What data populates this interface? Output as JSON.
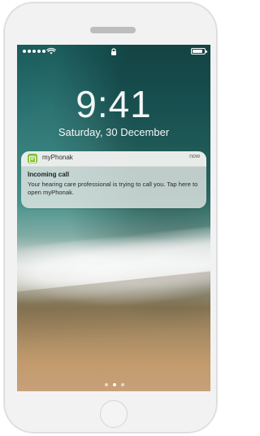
{
  "lock_screen": {
    "time": "9:41",
    "date": "Saturday, 30 December",
    "battery_level": 0.85
  },
  "notification": {
    "app_name": "myPhonak",
    "timestamp": "now",
    "title": "Incoming call",
    "body": "Your hearing care professional is trying to call you. Tap here to open myPhonak.",
    "app_icon": "myphonak-app-icon",
    "accent_color": "#7fbf2e"
  },
  "status_bar": {
    "icons": [
      "signal-dots-icon",
      "wifi-icon",
      "lock-icon",
      "battery-icon"
    ]
  },
  "page_indicator": {
    "count": 3,
    "active_index": 1
  }
}
